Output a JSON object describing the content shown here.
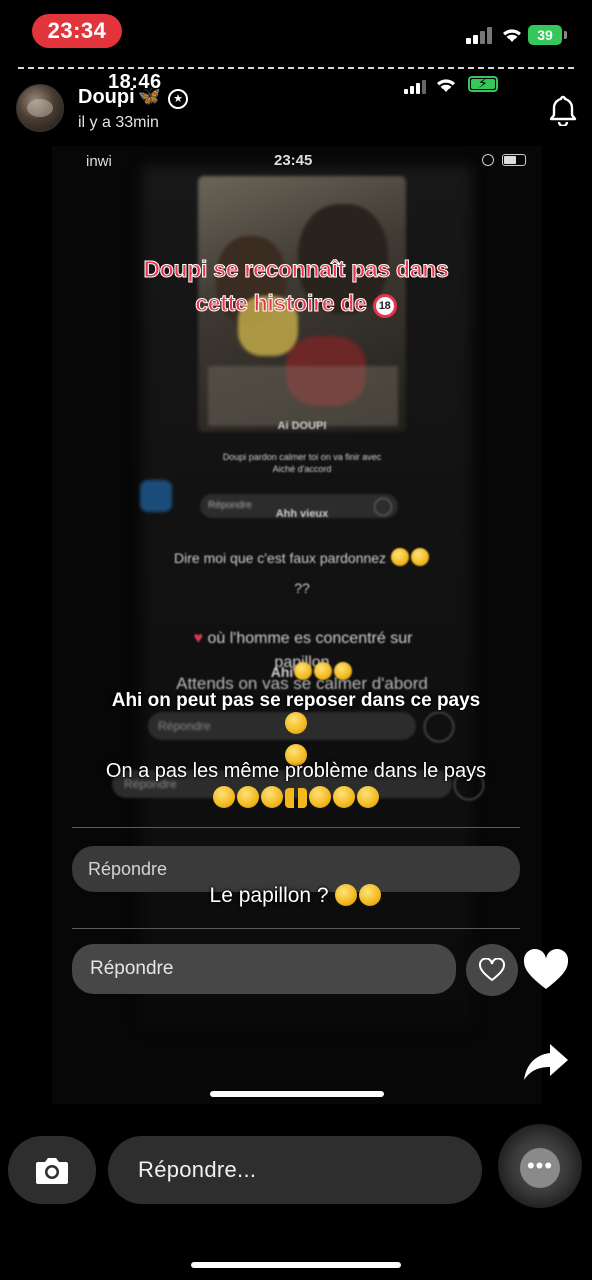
{
  "status_bar": {
    "time": "23:34",
    "battery": "39"
  },
  "story_header": {
    "recorded_time": "18:46",
    "username": "Doupi",
    "username_emoji": "🦋",
    "posted_ago": "il y a 33min"
  },
  "recorded_screen": {
    "carrier": "inwi",
    "time": "23:45",
    "blurred_lines": {
      "caption_1": "Ai DOUPI",
      "caption_2": "Doupi pardon calmer toi on va finir avec",
      "caption_3": "Aiché d'accord",
      "reply_pill_1": "Répondre",
      "pill_text": "Ahh vieux",
      "line_1": "Dire moi que c'est faux pardonnez",
      "line_2": "??",
      "line_3": "où l'homme es concentré sur",
      "line_4": "papillon",
      "line_5": "Ahi",
      "line_6": "Attends on vas se calmer d'abord",
      "reply_pill_2": "Répondre",
      "reply_pill_3": "Répondre"
    }
  },
  "overlays": {
    "red_line_1": "Doupi se reconnaît pas dans",
    "red_line_2": "cette histoire de",
    "no18_icon_text": "18",
    "white_1": "Ahi on peut pas se reposer dans ce pays",
    "white_2": "On a pas les même problème dans le pays",
    "reply_1": "Répondre",
    "white_3": "Le papillon ?",
    "reply_2": "Répondre"
  },
  "bottom_bar": {
    "reply_placeholder": "Répondre...",
    "more_label": "•••"
  },
  "icons": {
    "signal": "signal-icon",
    "wifi": "wifi-icon",
    "battery": "battery-icon",
    "bell": "bell-icon",
    "heart": "heart-icon",
    "share": "share-icon",
    "camera": "camera-icon",
    "more": "more-icon"
  },
  "colors": {
    "status_pill": "#e2343b",
    "battery_green": "#35c759",
    "overlay_red": "#e8344a"
  }
}
